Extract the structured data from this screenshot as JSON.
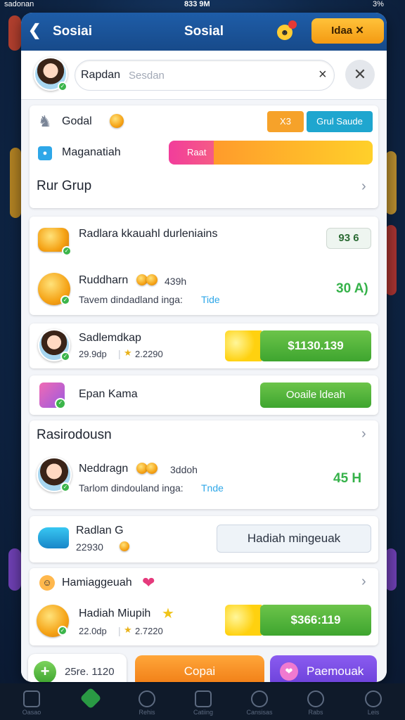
{
  "status_bar": {
    "left": "sadonan",
    "time": "833 9M",
    "battery": "3%"
  },
  "header": {
    "title_left": "Sosiai",
    "title_center": "Sosial",
    "pill_label": "Idaa"
  },
  "search": {
    "name": "Rapdan",
    "placeholder": "Sesdan"
  },
  "summary": {
    "row1_label": "Godal",
    "row1_badge": "X3",
    "row1_button": "Grul Saude",
    "row2_label": "Maganatiah",
    "row2_bar_label": "Raat"
  },
  "section1": {
    "title": "Rur Grup"
  },
  "items1": [
    {
      "title": "Radlara kkauahl durleniains",
      "badge": "93 6"
    },
    {
      "title": "Ruddharn",
      "title_extra": "439h",
      "subtitle": "Tavem dindadland inga:",
      "link": "Tide",
      "value": "30 A)"
    }
  ],
  "friend1": {
    "name": "Sadlemdkap",
    "meta_left": "29.9dp",
    "meta_right": "2.2290",
    "price": "$1130.139"
  },
  "event": {
    "title": "Epan Kama",
    "button": "Ooaile ldeah"
  },
  "section2": {
    "title": "Rasirodousn"
  },
  "friend2": {
    "name": "Neddragn",
    "name_extra": "3ddoh",
    "subtitle": "Tarlom dindouland inga:",
    "link": "Tnde",
    "value": "45 H"
  },
  "gift": {
    "title": "Radlan G",
    "sub": "22930",
    "button": "Hadiah mingeuak"
  },
  "section3": {
    "title": "Hamiaggeuah"
  },
  "gift2": {
    "title": "Hadiah Miupih",
    "meta_left": "22.0dp",
    "meta_right": "2.7220",
    "price": "$366:119"
  },
  "footer": {
    "counter": "25re. 1120",
    "center_button": "Copai",
    "right_button": "Paemouak"
  },
  "navbar": {
    "items": [
      "Oasao",
      "",
      "Rehis",
      "Catiing",
      "Cansisas",
      "Rabs",
      "Leis"
    ]
  },
  "colors": {
    "header": "#1e5da8",
    "orange": "#f49a12",
    "green": "#3ea52f",
    "purple": "#7b4de6",
    "teal": "#2ea7e8"
  }
}
